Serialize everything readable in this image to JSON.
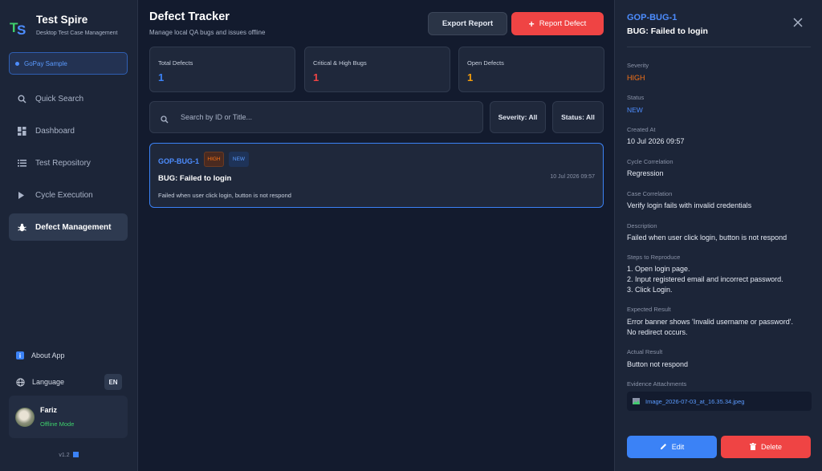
{
  "sidebar": {
    "app_title": "Test Spire",
    "app_subtitle": "Desktop Test Case Management",
    "project": "GoPay Sample",
    "nav": [
      {
        "label": "Quick Search",
        "icon": "search-icon"
      },
      {
        "label": "Dashboard",
        "icon": "grid-icon"
      },
      {
        "label": "Test Repository",
        "icon": "list-icon"
      },
      {
        "label": "Cycle Execution",
        "icon": "play-icon"
      },
      {
        "label": "Defect Management",
        "icon": "bug-icon",
        "active": true
      }
    ],
    "about": "About App",
    "language_label": "Language",
    "language_value": "EN",
    "user_name": "Fariz",
    "user_status": "Offline Mode",
    "version": "v1.2"
  },
  "main": {
    "title": "Defect Tracker",
    "subtitle": "Manage local QA bugs and issues offline",
    "export_label": "Export Report",
    "report_label": "Report Defect",
    "stats": [
      {
        "label": "Total Defects",
        "value": "1",
        "color": "#3b82f6"
      },
      {
        "label": "Critical & High Bugs",
        "value": "1",
        "color": "#ef4444"
      },
      {
        "label": "Open Defects",
        "value": "1",
        "color": "#f59e0b"
      }
    ],
    "search_placeholder": "Search by ID or Title...",
    "severity_filter": "Severity: All",
    "status_filter": "Status: All",
    "defects": [
      {
        "id": "GOP-BUG-1",
        "severity": "HIGH",
        "status": "NEW",
        "title": "BUG: Failed to login",
        "date": "10 Jul 2026 09:57",
        "description": "Failed when user click login, button is not respond"
      }
    ]
  },
  "detail": {
    "id": "GOP-BUG-1",
    "title": "BUG: Failed to login",
    "severity_label": "Severity",
    "severity": "HIGH",
    "status_label": "Status",
    "status": "NEW",
    "created_label": "Created At",
    "created": "10 Jul 2026 09:57",
    "cycle_label": "Cycle Correlation",
    "cycle": "Regression",
    "case_label": "Case Correlation",
    "case": "Verify login fails with invalid credentials",
    "description_label": "Description",
    "description": "Failed when user click login, button is not respond",
    "steps_label": "Steps to Reproduce",
    "steps": [
      "1. Open login page.",
      "2. Input registered email and incorrect password.",
      "3. Click Login."
    ],
    "expected_label": "Expected Result",
    "expected": [
      "Error banner shows 'Invalid username or password'.",
      "No redirect occurs."
    ],
    "actual_label": "Actual Result",
    "actual": "Button not respond",
    "attachments_label": "Evidence Attachments",
    "attachment": "Image_2026-07-03_at_16.35.34.jpeg",
    "edit_label": "Edit",
    "delete_label": "Delete"
  }
}
